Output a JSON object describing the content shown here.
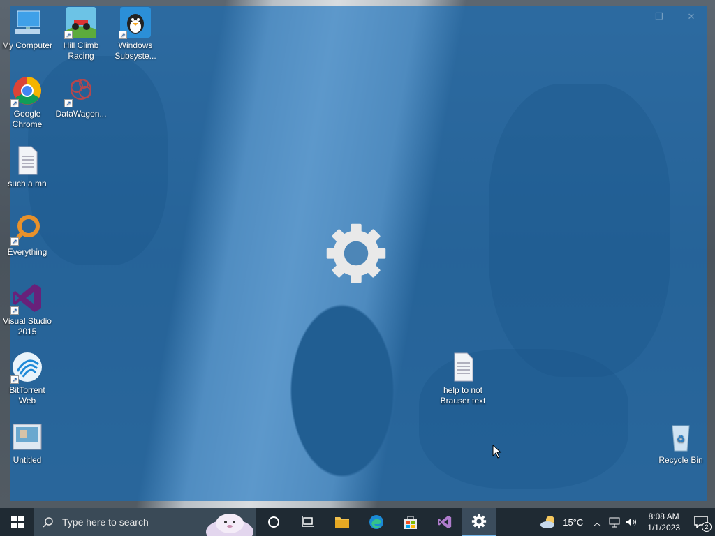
{
  "desktop": {
    "icons": [
      {
        "label": "My Computer",
        "icon": "computer-icon"
      },
      {
        "label": "Hill Climb Racing",
        "icon": "hill-climb-racing-icon"
      },
      {
        "label": "Windows Subsyste...",
        "icon": "wsl-penguin-icon"
      },
      {
        "label": "Google Chrome",
        "icon": "chrome-icon"
      },
      {
        "label": "DataWagon...",
        "icon": "datawagon-icon"
      },
      {
        "label": "such a mn",
        "icon": "text-file-icon"
      },
      {
        "label": "Everything",
        "icon": "everything-search-icon"
      },
      {
        "label": "Visual Studio 2015",
        "icon": "visual-studio-icon"
      },
      {
        "label": "BitTorrent Web",
        "icon": "bittorrent-icon"
      },
      {
        "label": "Untitled",
        "icon": "image-file-icon"
      },
      {
        "label": "help to not Brauser text",
        "icon": "text-file-icon"
      },
      {
        "label": "Recycle Bin",
        "icon": "recycle-bin-icon"
      }
    ]
  },
  "splash": {
    "app": "Settings",
    "controls": [
      "—",
      "❐",
      "✕"
    ]
  },
  "taskbar": {
    "search_placeholder": "Type here to search",
    "apps": [
      "Cortana",
      "Task View",
      "File Explorer",
      "Microsoft Edge",
      "Microsoft Store",
      "Visual Studio",
      "Settings"
    ],
    "weather": "15°C",
    "time": "8:08 AM",
    "date": "1/1/2023",
    "notification_count": "2"
  },
  "colors": {
    "overlay": "#106ebe",
    "taskbar": "#1f2a33",
    "accent": "#76b9ed"
  }
}
